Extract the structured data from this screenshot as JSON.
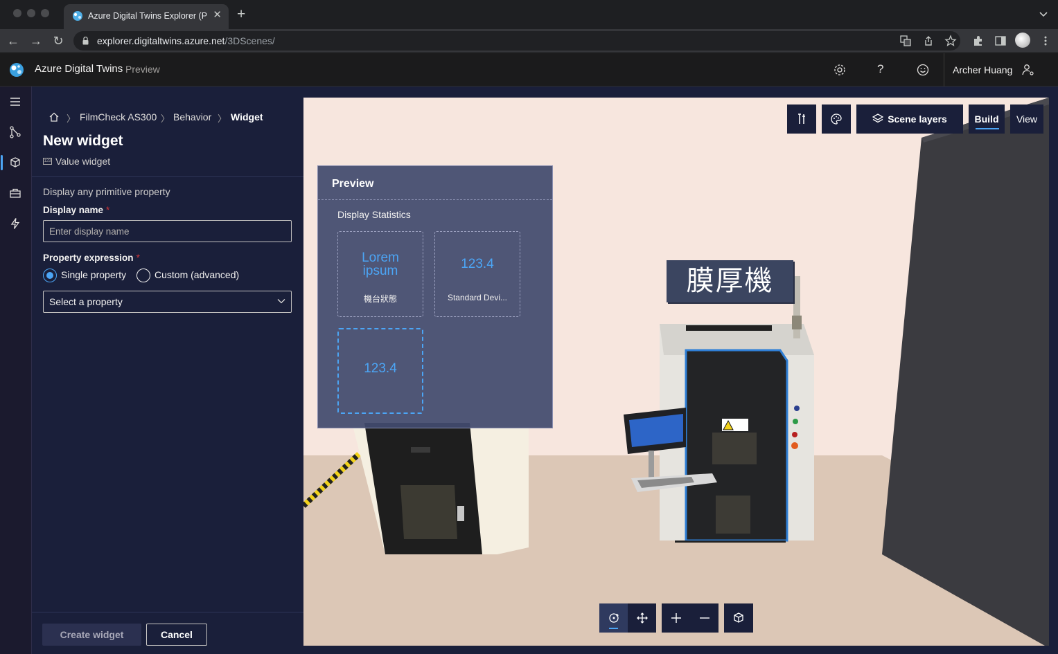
{
  "browser": {
    "tab_title": "Azure Digital Twins Explorer (P",
    "url_host": "explorer.digitaltwins.azure.net",
    "url_path": "/3DScenes/"
  },
  "app": {
    "title": "Azure Digital Twins",
    "subtitle": "Preview",
    "user_name": "Archer Huang",
    "help_label": "?"
  },
  "breadcrumb": {
    "items": [
      "FilmCheck AS300",
      "Behavior"
    ],
    "current": "Widget"
  },
  "panel": {
    "title": "New widget",
    "widget_type": "Value widget",
    "description": "Display any primitive property",
    "display_name_label": "Display name",
    "display_name_placeholder": "Enter display name",
    "property_expression_label": "Property expression",
    "required_mark": "*",
    "radio_single": "Single property",
    "radio_custom": "Custom (advanced)",
    "selected_radio": "Single property",
    "select_placeholder": "Select a property",
    "create_button": "Create widget",
    "cancel_button": "Cancel"
  },
  "viewer": {
    "scene_layers_label": "Scene layers",
    "build_label": "Build",
    "view_label": "View",
    "active_mode": "Build"
  },
  "preview": {
    "title": "Preview",
    "group_name": "Display Statistics",
    "tiles": [
      {
        "value_line1": "Lorem",
        "value_line2": "ipsum",
        "label": "機台狀態"
      },
      {
        "value": "123.4",
        "label": "Standard Devi..."
      },
      {
        "value": "123.4",
        "label": ""
      }
    ]
  },
  "scene": {
    "sign_text": "膜厚機"
  },
  "colors": {
    "accent": "#4ca5f5",
    "panel_bg": "#1a1f3a",
    "header_bg": "#1b1b1c",
    "scene_wall": "#f7e6de",
    "scene_floor": "#dcc7b6"
  },
  "icons": {
    "nav_rail": [
      "hamburger-icon",
      "graph-icon",
      "3d-scenes-icon",
      "toolbox-icon",
      "lightning-icon"
    ],
    "header": [
      "settings-icon",
      "help-icon",
      "feedback-smiley-icon",
      "user-settings-icon"
    ],
    "viewer_toolbar": [
      "tools-icon",
      "palette-icon",
      "layers-icon"
    ],
    "bottom_tools": [
      "orbit-icon",
      "pan-icon",
      "zoom-in-icon",
      "zoom-out-icon",
      "reset-view-cube-icon"
    ]
  }
}
